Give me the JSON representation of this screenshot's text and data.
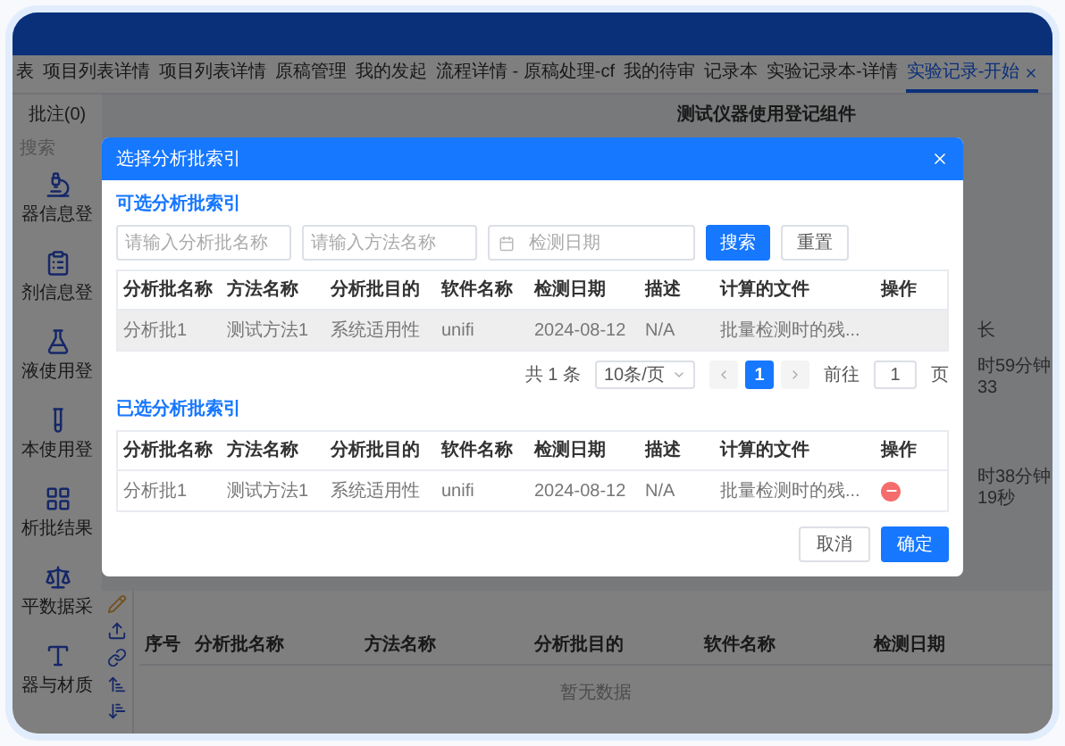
{
  "tabs": [
    {
      "label": "表",
      "selected": false
    },
    {
      "label": "项目列表详情",
      "selected": false
    },
    {
      "label": "项目列表详情",
      "selected": false
    },
    {
      "label": "原稿管理",
      "selected": false
    },
    {
      "label": "我的发起",
      "selected": false
    },
    {
      "label": "流程详情 - 原稿处理-cf",
      "selected": false
    },
    {
      "label": "我的待审",
      "selected": false
    },
    {
      "label": "记录本",
      "selected": false
    },
    {
      "label": "实验记录本-详情",
      "selected": false
    },
    {
      "label": "实验记录-开始",
      "selected": true
    }
  ],
  "sidebar": {
    "header": "批注(0)",
    "search_placeholder": "搜索",
    "items": [
      {
        "label": "器信息登"
      },
      {
        "label": "剂信息登"
      },
      {
        "label": "液使用登"
      },
      {
        "label": "本使用登"
      },
      {
        "label": "析批结果"
      },
      {
        "label": "平数据采"
      },
      {
        "label": "器与材质"
      }
    ]
  },
  "main": {
    "title": "测试仪器使用登记组件",
    "side_texts": [
      "长",
      "时59分钟33",
      "时38分钟19秒"
    ],
    "records_table": {
      "columns": [
        "序号",
        "分析批名称",
        "方法名称",
        "分析批目的",
        "软件名称",
        "检测日期"
      ],
      "empty_text": "暂无数据"
    }
  },
  "dialog": {
    "title": "选择分析批索引",
    "available": {
      "title": "可选分析批索引",
      "filters": [
        {
          "kind": "text",
          "placeholder": "请输入分析批名称"
        },
        {
          "kind": "text",
          "placeholder": "请输入方法名称"
        },
        {
          "kind": "date",
          "placeholder": "检测日期"
        }
      ],
      "search_button": "搜索",
      "reset_button": "重置",
      "columns": [
        "分析批名称",
        "方法名称",
        "分析批目的",
        "软件名称",
        "检测日期",
        "描述",
        "计算的文件",
        "操作"
      ],
      "rows": [
        {
          "cells": [
            "分析批1",
            "测试方法1",
            "系统适用性",
            "unifi",
            "2024-08-12",
            "N/A",
            "批量检测时的残..."
          ],
          "highlighted": true
        }
      ],
      "pagination": {
        "total": "共 1 条",
        "page_size": "10条/页",
        "pages": [
          {
            "label": "1",
            "selected": true
          }
        ],
        "goto_label": "前往",
        "goto_value": "1",
        "goto_suffix": "页"
      }
    },
    "chosen": {
      "title": "已选分析批索引",
      "columns": [
        "分析批名称",
        "方法名称",
        "分析批目的",
        "软件名称",
        "检测日期",
        "描述",
        "计算的文件",
        "操作"
      ],
      "rows": [
        {
          "cells": [
            "分析批1",
            "测试方法1",
            "系统适用性",
            "unifi",
            "2024-08-12",
            "N/A",
            "批量检测时的残..."
          ]
        }
      ]
    },
    "buttons": [
      {
        "label": "取消",
        "kind": "default"
      },
      {
        "label": "确定",
        "kind": "primary"
      }
    ]
  }
}
